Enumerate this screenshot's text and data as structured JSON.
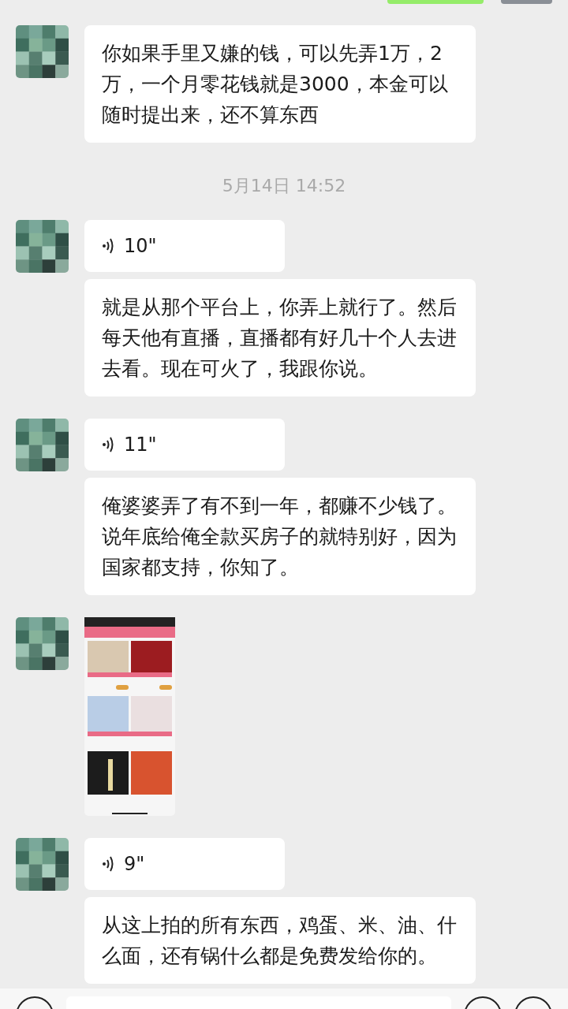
{
  "chat": [
    {
      "kind": "outgoing_cut"
    },
    {
      "kind": "group",
      "messages": [
        {
          "kind": "text",
          "text": "你如果手里又嫌的钱，可以先弄1万，2万，一个月零花钱就是3000，本金可以随时提出来，还不算东西"
        }
      ]
    },
    {
      "kind": "time",
      "text": "5月14日 14:52"
    },
    {
      "kind": "group",
      "messages": [
        {
          "kind": "voice",
          "duration": "10\""
        },
        {
          "kind": "text",
          "text": "就是从那个平台上，你弄上就行了。然后每天他有直播，直播都有好几十个人去进去看。现在可火了，我跟你说。"
        }
      ]
    },
    {
      "kind": "group",
      "messages": [
        {
          "kind": "voice",
          "duration": "11\""
        },
        {
          "kind": "text",
          "text": "俺婆婆弄了有不到一年，都赚不少钱了。说年底给俺全款买房子的就特别好，因为国家都支持，你知了。"
        }
      ]
    },
    {
      "kind": "group"
    },
    {
      "kind": "group",
      "messages": [
        {
          "kind": "voice",
          "duration": "9\""
        },
        {
          "kind": "text",
          "text": "从这上拍的所有东西，鸡蛋、米、油、什么面，还有锅什么都是免费发给你的。"
        }
      ]
    }
  ]
}
